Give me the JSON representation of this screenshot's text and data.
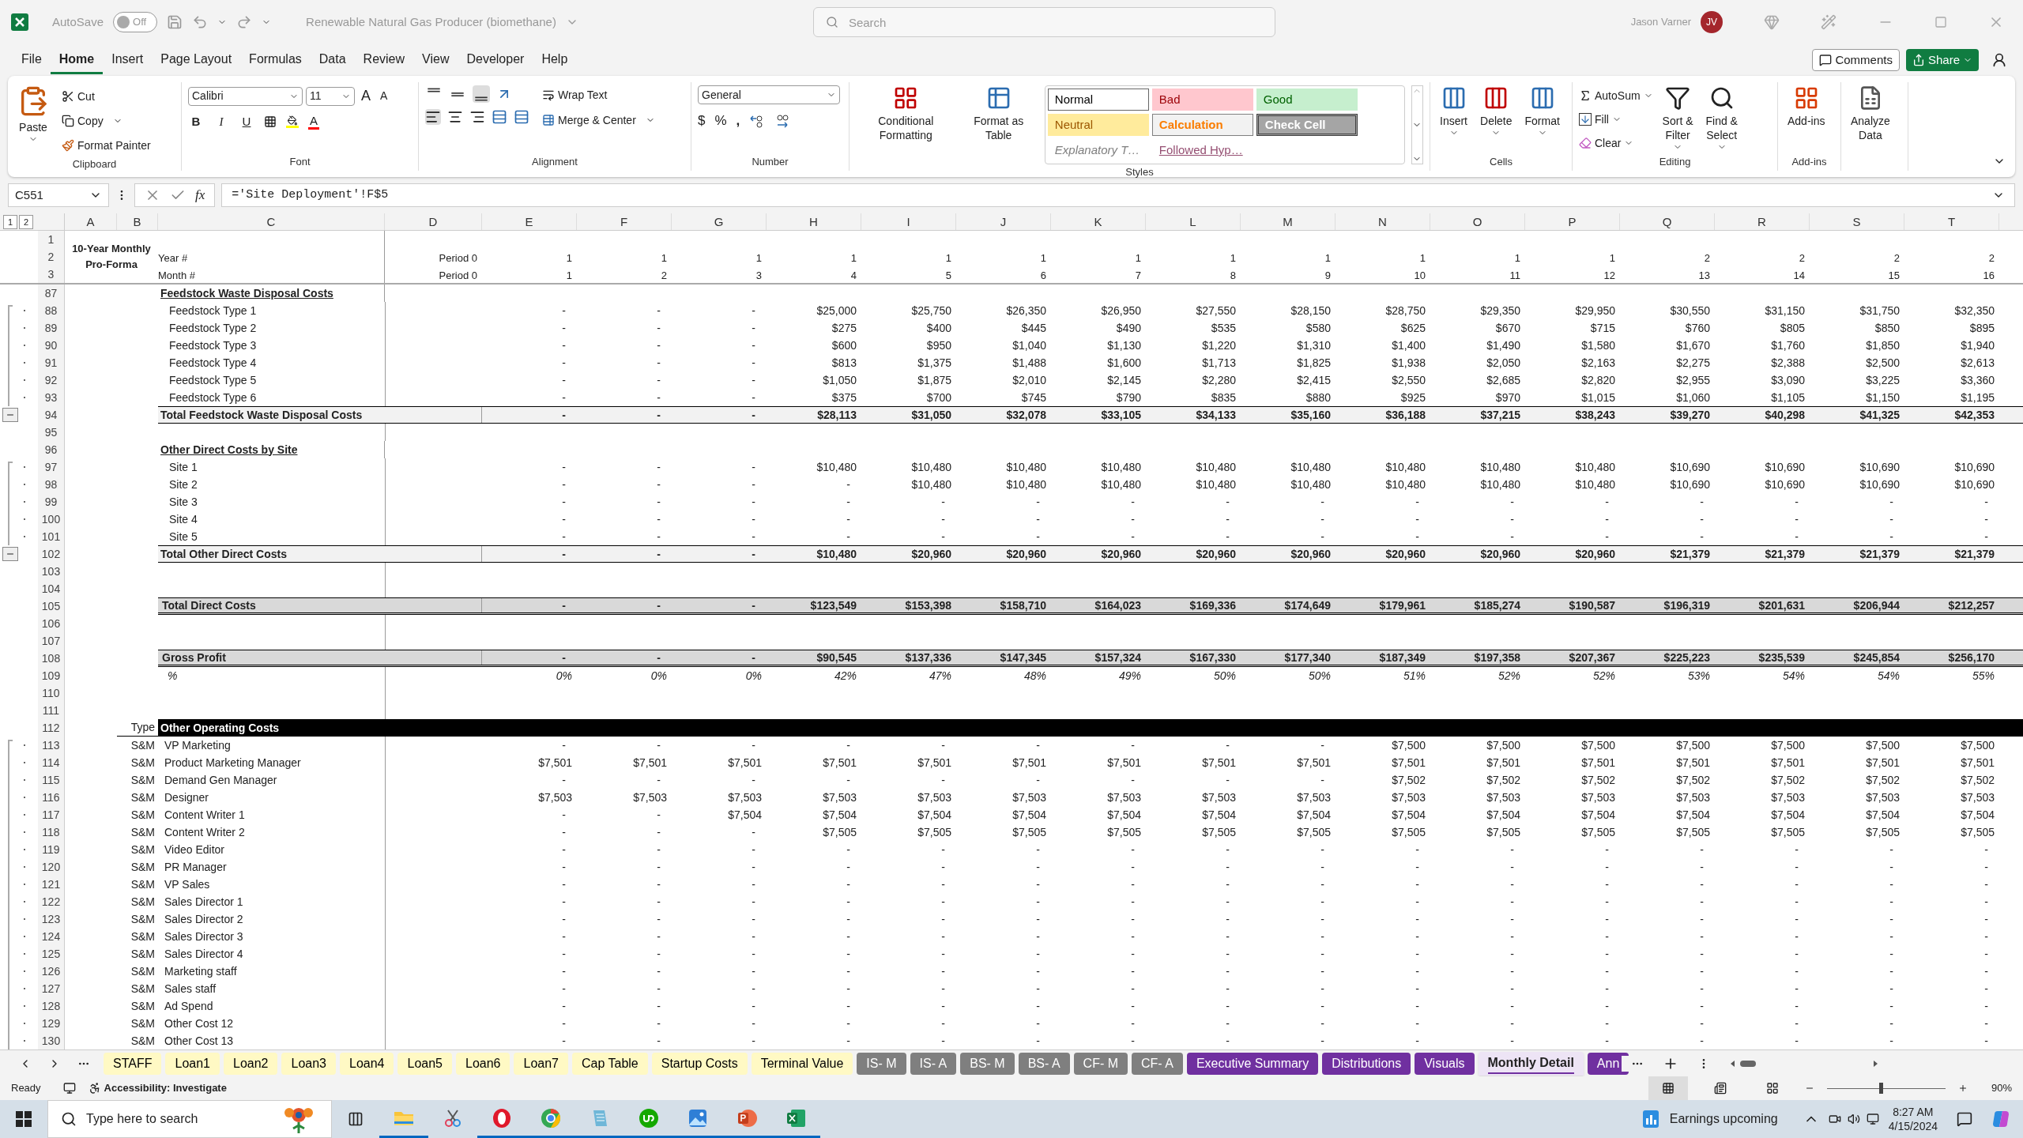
{
  "titlebar": {
    "autosave": {
      "label": "AutoSave",
      "on": false,
      "state_text": "Off"
    },
    "title": "Renewable Natural Gas Producer (biomethane)",
    "search_placeholder": "Search",
    "user": "Jason Varner",
    "initials": "JV"
  },
  "menu": {
    "tabs": [
      {
        "label": "File",
        "selected": false
      },
      {
        "label": "Home",
        "selected": true
      },
      {
        "label": "Insert",
        "selected": false
      },
      {
        "label": "Page Layout",
        "selected": false
      },
      {
        "label": "Formulas",
        "selected": false
      },
      {
        "label": "Data",
        "selected": false
      },
      {
        "label": "Review",
        "selected": false
      },
      {
        "label": "View",
        "selected": false
      },
      {
        "label": "Developer",
        "selected": false
      },
      {
        "label": "Help",
        "selected": false
      }
    ],
    "comments": "Comments",
    "share": "Share"
  },
  "ribbon": {
    "groups": [
      {
        "kind": "clipboard",
        "label": "Clipboard",
        "paste": "Paste",
        "items": [
          "Cut",
          "Copy",
          "Format Painter"
        ]
      },
      {
        "kind": "font",
        "label": "Font",
        "font": "Calibri",
        "size": "11",
        "grow": "A",
        "shrink": "A",
        "bold": "B",
        "italic": "I",
        "underline": "U",
        "font_color": "A"
      },
      {
        "kind": "alignment",
        "label": "Alignment",
        "wrap": "Wrap Text",
        "merge": "Merge & Center"
      },
      {
        "kind": "number",
        "label": "Number",
        "format": "General",
        "currency": "$",
        "percent": "%",
        "comma": ","
      },
      {
        "kind": "styles",
        "label": "Styles",
        "buttons": [
          "Conditional Formatting",
          "Format as Table"
        ],
        "cell_styles": [
          {
            "label": "Normal",
            "kind": "normal"
          },
          {
            "label": "Bad",
            "kind": "bad"
          },
          {
            "label": "Good",
            "kind": "good"
          },
          {
            "label": "Neutral",
            "kind": "neutral"
          },
          {
            "label": "Calculation",
            "kind": "calculation"
          },
          {
            "label": "Check Cell",
            "kind": "check"
          },
          {
            "label": "Explanatory T…",
            "kind": "explanatory"
          },
          {
            "label": "Followed Hyp…",
            "kind": "hyperlink"
          }
        ]
      },
      {
        "kind": "cells",
        "label": "Cells",
        "buttons": [
          "Insert",
          "Delete",
          "Format"
        ]
      },
      {
        "kind": "editing",
        "label": "Editing",
        "items": [
          "AutoSum",
          "Fill",
          "Clear"
        ],
        "buttons": [
          "Sort & Filter",
          "Find & Select"
        ]
      },
      {
        "kind": "addins",
        "label": "Add-ins",
        "buttons": [
          "Add-ins"
        ]
      },
      {
        "kind": "analyze",
        "buttons": [
          "Analyze Data"
        ]
      }
    ]
  },
  "formula_bar": {
    "name_box": "C551",
    "fx": "fx",
    "formula": "='Site Deployment'!F$5"
  },
  "sheet": {
    "outline_levels": [
      "1",
      "2"
    ],
    "columns": [
      "A",
      "B",
      "C",
      "D",
      "E",
      "F",
      "G",
      "H",
      "I",
      "J",
      "K",
      "L",
      "M",
      "N",
      "O",
      "P",
      "Q",
      "R",
      "S",
      "T"
    ],
    "title": "10-Year Monthly Pro-Forma",
    "header_rows": [
      {
        "n": "1"
      },
      {
        "n": "2",
        "label": "Year #",
        "period": "Period 0",
        "values": [
          "1",
          "1",
          "1",
          "1",
          "1",
          "1",
          "1",
          "1",
          "1",
          "1",
          "1",
          "1",
          "2",
          "2",
          "2",
          "2"
        ]
      },
      {
        "n": "3",
        "label": "Month #",
        "period": "Period 0",
        "values": [
          "1",
          "2",
          "3",
          "4",
          "5",
          "6",
          "7",
          "8",
          "9",
          "10",
          "11",
          "12",
          "13",
          "14",
          "15",
          "16"
        ]
      }
    ],
    "rows": [
      {
        "n": "87",
        "kind": "section",
        "grouped": false,
        "collapse_button": false,
        "label": "Feedstock Waste Disposal Costs"
      },
      {
        "n": "88",
        "kind": "item",
        "grouped": true,
        "collapse_button": false,
        "label": "Feedstock Type 1",
        "values": [
          "-",
          "-",
          "-",
          "$25,000",
          "$25,750",
          "$26,350",
          "$26,950",
          "$27,550",
          "$28,150",
          "$28,750",
          "$29,350",
          "$29,950",
          "$30,550",
          "$31,150",
          "$31,750",
          "$32,350"
        ]
      },
      {
        "n": "89",
        "kind": "item",
        "grouped": true,
        "collapse_button": false,
        "label": "Feedstock Type 2",
        "values": [
          "-",
          "-",
          "-",
          "$275",
          "$400",
          "$445",
          "$490",
          "$535",
          "$580",
          "$625",
          "$670",
          "$715",
          "$760",
          "$805",
          "$850",
          "$895"
        ]
      },
      {
        "n": "90",
        "kind": "item",
        "grouped": true,
        "collapse_button": false,
        "label": "Feedstock Type 3",
        "values": [
          "-",
          "-",
          "-",
          "$600",
          "$950",
          "$1,040",
          "$1,130",
          "$1,220",
          "$1,310",
          "$1,400",
          "$1,490",
          "$1,580",
          "$1,670",
          "$1,760",
          "$1,850",
          "$1,940"
        ]
      },
      {
        "n": "91",
        "kind": "item",
        "grouped": true,
        "collapse_button": false,
        "label": "Feedstock Type 4",
        "values": [
          "-",
          "-",
          "-",
          "$813",
          "$1,375",
          "$1,488",
          "$1,600",
          "$1,713",
          "$1,825",
          "$1,938",
          "$2,050",
          "$2,163",
          "$2,275",
          "$2,388",
          "$2,500",
          "$2,613"
        ]
      },
      {
        "n": "92",
        "kind": "item",
        "grouped": true,
        "collapse_button": false,
        "label": "Feedstock Type 5",
        "values": [
          "-",
          "-",
          "-",
          "$1,050",
          "$1,875",
          "$2,010",
          "$2,145",
          "$2,280",
          "$2,415",
          "$2,550",
          "$2,685",
          "$2,820",
          "$2,955",
          "$3,090",
          "$3,225",
          "$3,360"
        ]
      },
      {
        "n": "93",
        "kind": "item",
        "grouped": true,
        "collapse_button": false,
        "label": "Feedstock Type 6",
        "values": [
          "-",
          "-",
          "-",
          "$375",
          "$700",
          "$745",
          "$790",
          "$835",
          "$880",
          "$925",
          "$970",
          "$1,015",
          "$1,060",
          "$1,105",
          "$1,150",
          "$1,195"
        ]
      },
      {
        "n": "94",
        "kind": "total",
        "grouped": false,
        "collapse_button": true,
        "label": "Total Feedstock Waste Disposal Costs",
        "values": [
          "-",
          "-",
          "-",
          "$28,113",
          "$31,050",
          "$32,078",
          "$33,105",
          "$34,133",
          "$35,160",
          "$36,188",
          "$37,215",
          "$38,243",
          "$39,270",
          "$40,298",
          "$41,325",
          "$42,353"
        ]
      },
      {
        "n": "95",
        "kind": "blank",
        "grouped": false,
        "collapse_button": false
      },
      {
        "n": "96",
        "kind": "section",
        "grouped": false,
        "collapse_button": false,
        "label": "Other Direct Costs by Site"
      },
      {
        "n": "97",
        "kind": "item",
        "grouped": true,
        "collapse_button": false,
        "label": "Site 1",
        "values": [
          "-",
          "-",
          "-",
          "$10,480",
          "$10,480",
          "$10,480",
          "$10,480",
          "$10,480",
          "$10,480",
          "$10,480",
          "$10,480",
          "$10,480",
          "$10,690",
          "$10,690",
          "$10,690",
          "$10,690"
        ]
      },
      {
        "n": "98",
        "kind": "item",
        "grouped": true,
        "collapse_button": false,
        "label": "Site 2",
        "values": [
          "-",
          "-",
          "-",
          "-",
          "$10,480",
          "$10,480",
          "$10,480",
          "$10,480",
          "$10,480",
          "$10,480",
          "$10,480",
          "$10,480",
          "$10,690",
          "$10,690",
          "$10,690",
          "$10,690"
        ]
      },
      {
        "n": "99",
        "kind": "item",
        "grouped": true,
        "collapse_button": false,
        "label": "Site 3",
        "values": [
          "-",
          "-",
          "-",
          "-",
          "-",
          "-",
          "-",
          "-",
          "-",
          "-",
          "-",
          "-",
          "-",
          "-",
          "-",
          "-"
        ]
      },
      {
        "n": "100",
        "kind": "item",
        "grouped": true,
        "collapse_button": false,
        "label": "Site 4",
        "values": [
          "-",
          "-",
          "-",
          "-",
          "-",
          "-",
          "-",
          "-",
          "-",
          "-",
          "-",
          "-",
          "-",
          "-",
          "-",
          "-"
        ]
      },
      {
        "n": "101",
        "kind": "item",
        "grouped": true,
        "collapse_button": false,
        "label": "Site 5",
        "values": [
          "-",
          "-",
          "-",
          "-",
          "-",
          "-",
          "-",
          "-",
          "-",
          "-",
          "-",
          "-",
          "-",
          "-",
          "-",
          "-"
        ]
      },
      {
        "n": "102",
        "kind": "total",
        "grouped": false,
        "collapse_button": true,
        "label": "Total Other Direct Costs",
        "values": [
          "-",
          "-",
          "-",
          "$10,480",
          "$20,960",
          "$20,960",
          "$20,960",
          "$20,960",
          "$20,960",
          "$20,960",
          "$20,960",
          "$20,960",
          "$21,379",
          "$21,379",
          "$21,379",
          "$21,379"
        ]
      },
      {
        "n": "103",
        "kind": "blank",
        "grouped": false,
        "collapse_button": false
      },
      {
        "n": "104",
        "kind": "blank",
        "grouped": false,
        "collapse_button": false
      },
      {
        "n": "105",
        "kind": "grand_total",
        "grouped": false,
        "collapse_button": false,
        "label": "Total Direct Costs",
        "values": [
          "-",
          "-",
          "-",
          "$123,549",
          "$153,398",
          "$158,710",
          "$164,023",
          "$169,336",
          "$174,649",
          "$179,961",
          "$185,274",
          "$190,587",
          "$196,319",
          "$201,631",
          "$206,944",
          "$212,257"
        ]
      },
      {
        "n": "106",
        "kind": "blank",
        "grouped": false,
        "collapse_button": false
      },
      {
        "n": "107",
        "kind": "blank",
        "grouped": false,
        "collapse_button": false
      },
      {
        "n": "108",
        "kind": "grand_total",
        "grouped": false,
        "collapse_button": false,
        "label": "Gross Profit",
        "values": [
          "-",
          "-",
          "-",
          "$90,545",
          "$137,336",
          "$147,345",
          "$157,324",
          "$167,330",
          "$177,340",
          "$187,349",
          "$197,358",
          "$207,367",
          "$225,223",
          "$235,539",
          "$245,854",
          "$256,170"
        ]
      },
      {
        "n": "109",
        "kind": "percent",
        "grouped": false,
        "collapse_button": false,
        "label": "%",
        "values": [
          "0%",
          "0%",
          "0%",
          "42%",
          "47%",
          "48%",
          "49%",
          "50%",
          "50%",
          "51%",
          "52%",
          "52%",
          "53%",
          "54%",
          "54%",
          "55%"
        ]
      },
      {
        "n": "110",
        "kind": "blank",
        "grouped": false,
        "collapse_button": false
      },
      {
        "n": "111",
        "kind": "blank",
        "grouped": false,
        "collapse_button": false
      },
      {
        "n": "112",
        "kind": "band",
        "grouped": false,
        "collapse_button": false,
        "type": "Type",
        "label": "Other Operating Costs"
      },
      {
        "n": "113",
        "kind": "item",
        "grouped": true,
        "collapse_button": false,
        "type": "S&M",
        "label": "VP Marketing",
        "values": [
          "-",
          "-",
          "-",
          "-",
          "-",
          "-",
          "-",
          "-",
          "-",
          "$7,500",
          "$7,500",
          "$7,500",
          "$7,500",
          "$7,500",
          "$7,500",
          "$7,500"
        ]
      },
      {
        "n": "114",
        "kind": "item",
        "grouped": true,
        "collapse_button": false,
        "type": "S&M",
        "label": "Product Marketing Manager",
        "values": [
          "$7,501",
          "$7,501",
          "$7,501",
          "$7,501",
          "$7,501",
          "$7,501",
          "$7,501",
          "$7,501",
          "$7,501",
          "$7,501",
          "$7,501",
          "$7,501",
          "$7,501",
          "$7,501",
          "$7,501",
          "$7,501"
        ]
      },
      {
        "n": "115",
        "kind": "item",
        "grouped": true,
        "collapse_button": false,
        "type": "S&M",
        "label": "Demand Gen Manager",
        "values": [
          "-",
          "-",
          "-",
          "-",
          "-",
          "-",
          "-",
          "-",
          "-",
          "$7,502",
          "$7,502",
          "$7,502",
          "$7,502",
          "$7,502",
          "$7,502",
          "$7,502"
        ]
      },
      {
        "n": "116",
        "kind": "item",
        "grouped": true,
        "collapse_button": false,
        "type": "S&M",
        "label": "Designer",
        "values": [
          "$7,503",
          "$7,503",
          "$7,503",
          "$7,503",
          "$7,503",
          "$7,503",
          "$7,503",
          "$7,503",
          "$7,503",
          "$7,503",
          "$7,503",
          "$7,503",
          "$7,503",
          "$7,503",
          "$7,503",
          "$7,503"
        ]
      },
      {
        "n": "117",
        "kind": "item",
        "grouped": true,
        "collapse_button": false,
        "type": "S&M",
        "label": "Content Writer 1",
        "values": [
          "-",
          "-",
          "$7,504",
          "$7,504",
          "$7,504",
          "$7,504",
          "$7,504",
          "$7,504",
          "$7,504",
          "$7,504",
          "$7,504",
          "$7,504",
          "$7,504",
          "$7,504",
          "$7,504",
          "$7,504"
        ]
      },
      {
        "n": "118",
        "kind": "item",
        "grouped": true,
        "collapse_button": false,
        "type": "S&M",
        "label": "Content Writer 2",
        "values": [
          "-",
          "-",
          "-",
          "$7,505",
          "$7,505",
          "$7,505",
          "$7,505",
          "$7,505",
          "$7,505",
          "$7,505",
          "$7,505",
          "$7,505",
          "$7,505",
          "$7,505",
          "$7,505",
          "$7,505"
        ]
      },
      {
        "n": "119",
        "kind": "item",
        "grouped": true,
        "collapse_button": false,
        "type": "S&M",
        "label": "Video Editor",
        "values": [
          "-",
          "-",
          "-",
          "-",
          "-",
          "-",
          "-",
          "-",
          "-",
          "-",
          "-",
          "-",
          "-",
          "-",
          "-",
          "-"
        ]
      },
      {
        "n": "120",
        "kind": "item",
        "grouped": true,
        "collapse_button": false,
        "type": "S&M",
        "label": "PR Manager",
        "values": [
          "-",
          "-",
          "-",
          "-",
          "-",
          "-",
          "-",
          "-",
          "-",
          "-",
          "-",
          "-",
          "-",
          "-",
          "-",
          "-"
        ]
      },
      {
        "n": "121",
        "kind": "item",
        "grouped": true,
        "collapse_button": false,
        "type": "S&M",
        "label": "VP Sales",
        "values": [
          "-",
          "-",
          "-",
          "-",
          "-",
          "-",
          "-",
          "-",
          "-",
          "-",
          "-",
          "-",
          "-",
          "-",
          "-",
          "-"
        ]
      },
      {
        "n": "122",
        "kind": "item",
        "grouped": true,
        "collapse_button": false,
        "type": "S&M",
        "label": "Sales Director 1",
        "values": [
          "-",
          "-",
          "-",
          "-",
          "-",
          "-",
          "-",
          "-",
          "-",
          "-",
          "-",
          "-",
          "-",
          "-",
          "-",
          "-"
        ]
      },
      {
        "n": "123",
        "kind": "item",
        "grouped": true,
        "collapse_button": false,
        "type": "S&M",
        "label": "Sales Director 2",
        "values": [
          "-",
          "-",
          "-",
          "-",
          "-",
          "-",
          "-",
          "-",
          "-",
          "-",
          "-",
          "-",
          "-",
          "-",
          "-",
          "-"
        ]
      },
      {
        "n": "124",
        "kind": "item",
        "grouped": true,
        "collapse_button": false,
        "type": "S&M",
        "label": "Sales Director 3",
        "values": [
          "-",
          "-",
          "-",
          "-",
          "-",
          "-",
          "-",
          "-",
          "-",
          "-",
          "-",
          "-",
          "-",
          "-",
          "-",
          "-"
        ]
      },
      {
        "n": "125",
        "kind": "item",
        "grouped": true,
        "collapse_button": false,
        "type": "S&M",
        "label": "Sales Director 4",
        "values": [
          "-",
          "-",
          "-",
          "-",
          "-",
          "-",
          "-",
          "-",
          "-",
          "-",
          "-",
          "-",
          "-",
          "-",
          "-",
          "-"
        ]
      },
      {
        "n": "126",
        "kind": "item",
        "grouped": true,
        "collapse_button": false,
        "type": "S&M",
        "label": "Marketing staff",
        "values": [
          "-",
          "-",
          "-",
          "-",
          "-",
          "-",
          "-",
          "-",
          "-",
          "-",
          "-",
          "-",
          "-",
          "-",
          "-",
          "-"
        ]
      },
      {
        "n": "127",
        "kind": "item",
        "grouped": true,
        "collapse_button": false,
        "type": "S&M",
        "label": "Sales staff",
        "values": [
          "-",
          "-",
          "-",
          "-",
          "-",
          "-",
          "-",
          "-",
          "-",
          "-",
          "-",
          "-",
          "-",
          "-",
          "-",
          "-"
        ]
      },
      {
        "n": "128",
        "kind": "item",
        "grouped": true,
        "collapse_button": false,
        "type": "S&M",
        "label": "Ad Spend",
        "values": [
          "-",
          "-",
          "-",
          "-",
          "-",
          "-",
          "-",
          "-",
          "-",
          "-",
          "-",
          "-",
          "-",
          "-",
          "-",
          "-"
        ]
      },
      {
        "n": "129",
        "kind": "item",
        "grouped": true,
        "collapse_button": false,
        "type": "S&M",
        "label": "Other Cost 12",
        "values": [
          "-",
          "-",
          "-",
          "-",
          "-",
          "-",
          "-",
          "-",
          "-",
          "-",
          "-",
          "-",
          "-",
          "-",
          "-",
          "-"
        ]
      },
      {
        "n": "130",
        "kind": "item",
        "grouped": true,
        "collapse_button": false,
        "type": "S&M",
        "label": "Other Cost 13",
        "values": [
          "-",
          "-",
          "-",
          "-",
          "-",
          "-",
          "-",
          "-",
          "-",
          "-",
          "-",
          "-",
          "-",
          "-",
          "-",
          "-"
        ]
      }
    ]
  },
  "sheet_tabs": {
    "tabs": [
      {
        "label": "STAFF",
        "color": "#fff9c4",
        "selected": false
      },
      {
        "label": "Loan1",
        "color": "#fff9c4",
        "selected": false
      },
      {
        "label": "Loan2",
        "color": "#fff9c4",
        "selected": false
      },
      {
        "label": "Loan3",
        "color": "#fff9c4",
        "selected": false
      },
      {
        "label": "Loan4",
        "color": "#fff9c4",
        "selected": false
      },
      {
        "label": "Loan5",
        "color": "#fff9c4",
        "selected": false
      },
      {
        "label": "Loan6",
        "color": "#fff9c4",
        "selected": false
      },
      {
        "label": "Loan7",
        "color": "#fff9c4",
        "selected": false
      },
      {
        "label": "Cap Table",
        "color": "#fff9c4",
        "selected": false
      },
      {
        "label": "Startup Costs",
        "color": "#fff9c4",
        "selected": false
      },
      {
        "label": "Terminal Value",
        "color": "#fff9c4",
        "selected": false
      },
      {
        "label": "IS- M",
        "color": "#7f7f7f",
        "selected": false
      },
      {
        "label": "IS- A",
        "color": "#7f7f7f",
        "selected": false
      },
      {
        "label": "BS- M",
        "color": "#7f7f7f",
        "selected": false
      },
      {
        "label": "BS- A",
        "color": "#7f7f7f",
        "selected": false
      },
      {
        "label": "CF- M",
        "color": "#7f7f7f",
        "selected": false
      },
      {
        "label": "CF- A",
        "color": "#7f7f7f",
        "selected": false
      },
      {
        "label": "Executive Summary",
        "color": "#7030a0",
        "selected": false
      },
      {
        "label": "Distributions",
        "color": "#7030a0",
        "selected": false
      },
      {
        "label": "Visuals",
        "color": "#7030a0",
        "selected": false
      },
      {
        "label": "Monthly Detail",
        "color": "#7030a0",
        "selected": true
      },
      {
        "label": "Ann",
        "color": "#7030a0",
        "selected": false
      }
    ]
  },
  "status_bar": {
    "ready": "Ready",
    "accessibility": "Accessibility: Investigate",
    "views": [
      {
        "kind": "normal",
        "selected": true
      },
      {
        "kind": "page_layout",
        "selected": false
      },
      {
        "kind": "page_break",
        "selected": false
      }
    ],
    "zoom": {
      "level": 0.45,
      "reading": "90%"
    }
  },
  "taskbar": {
    "search_placeholder": "Type here to search",
    "apps": [
      {
        "kind": "explorer",
        "running": true
      },
      {
        "kind": "snipping",
        "running": false
      },
      {
        "kind": "opera",
        "running": true
      },
      {
        "kind": "chrome",
        "running": true
      },
      {
        "kind": "notepad",
        "running": true
      },
      {
        "kind": "upwork",
        "running": true
      },
      {
        "kind": "photos",
        "running": true
      },
      {
        "kind": "powerpoint",
        "running": true
      },
      {
        "kind": "excel",
        "running": true
      }
    ],
    "widget": "Earnings upcoming",
    "time": "8:27 AM",
    "date": "4/15/2024"
  }
}
